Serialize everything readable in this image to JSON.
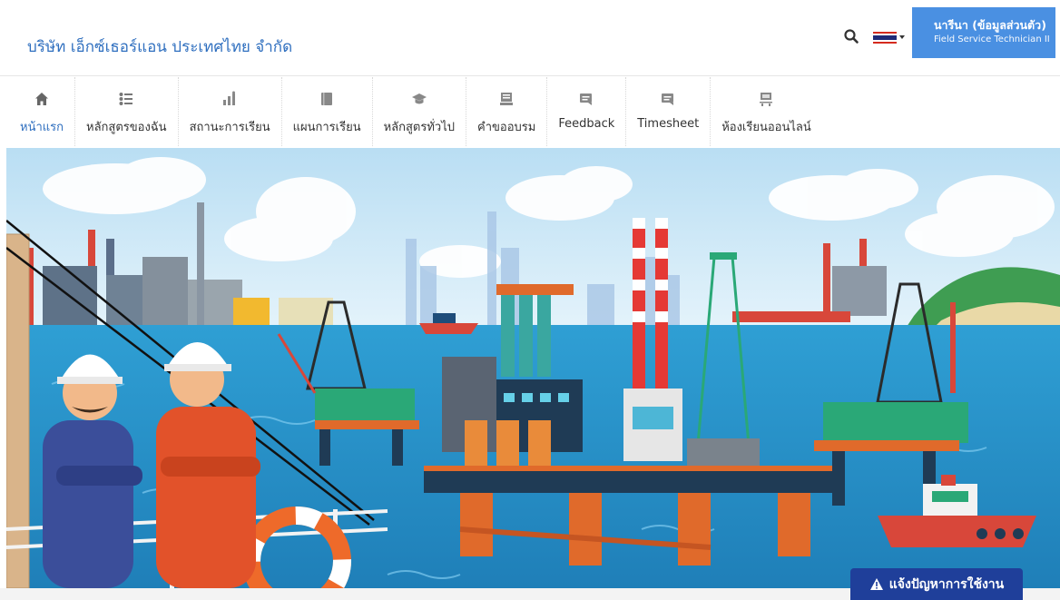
{
  "header": {
    "company_name": "บริษัท เอ็กซ์เธอร์แอน ประเทศไทย จำกัด",
    "user": {
      "name": "นารีนา (ข้อมูลส่วนตัว)",
      "role": "Field Service Technician II"
    },
    "search_icon": "search-icon",
    "language_flag": "thailand-flag"
  },
  "nav": {
    "items": [
      {
        "label": "หน้าแรก",
        "icon": "home-icon",
        "active": true
      },
      {
        "label": "หลักสูตรของฉัน",
        "icon": "list-icon",
        "active": false
      },
      {
        "label": "สถานะการเรียน",
        "icon": "status-chart-icon",
        "active": false
      },
      {
        "label": "แผนการเรียน",
        "icon": "book-icon",
        "active": false
      },
      {
        "label": "หลักสูตรทั่วไป",
        "icon": "graduation-cap-icon",
        "active": false
      },
      {
        "label": "คำขออบรม",
        "icon": "request-icon",
        "active": false
      },
      {
        "label": "Feedback",
        "icon": "chat-icon",
        "active": false
      },
      {
        "label": "Timesheet",
        "icon": "timesheet-icon",
        "active": false
      },
      {
        "label": "ห้องเรียนออนไลน์",
        "icon": "online-classroom-icon",
        "active": false
      }
    ]
  },
  "report_button": {
    "label": "แจ้งปัญหาการใช้งาน",
    "icon": "warning-icon"
  },
  "colors": {
    "brand": "#2f6fbf",
    "user_box": "#4a90e2",
    "report_button": "#1f3f9a",
    "sea": "#2b8fc4",
    "sky": "#cfe8f6"
  }
}
